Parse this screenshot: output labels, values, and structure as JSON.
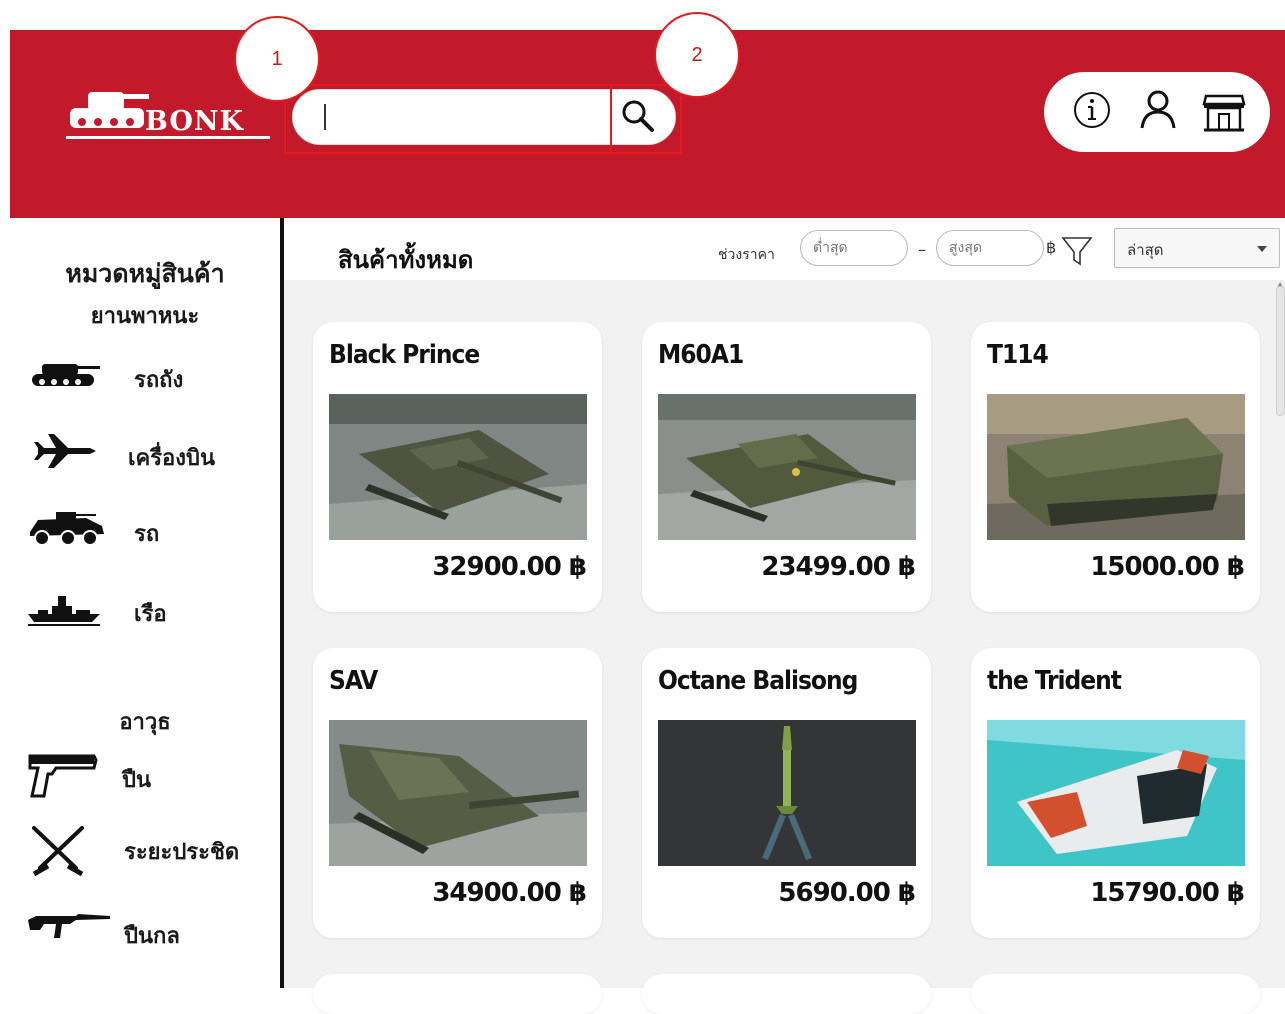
{
  "header": {
    "logo_text": "BONK",
    "search": {
      "value": "",
      "placeholder": ""
    },
    "annotations": [
      "1",
      "2"
    ],
    "icons": [
      "info-icon",
      "user-icon",
      "store-icon"
    ]
  },
  "sidebar": {
    "title": "หมวดหมู่สินค้า",
    "vehicles_heading": "ยานพาหนะ",
    "vehicles": [
      {
        "label": "รถถัง",
        "icon": "tank-icon"
      },
      {
        "label": "เครื่องบิน",
        "icon": "jet-icon"
      },
      {
        "label": "รถ",
        "icon": "armored-car-icon"
      },
      {
        "label": "เรือ",
        "icon": "ship-icon"
      }
    ],
    "weapons_heading": "อาวุธ",
    "weapons": [
      {
        "label": "ปืน",
        "icon": "pistol-icon"
      },
      {
        "label": "ระยะประชิด",
        "icon": "crossed-knives-icon"
      },
      {
        "label": "ปืนกล",
        "icon": "rifle-icon"
      }
    ]
  },
  "toolbar": {
    "title": "สินค้าทั้งหมด",
    "price_range_label": "ช่วงราคา",
    "min_placeholder": "ต่ำสุด",
    "max_placeholder": "สูงสุด",
    "dash": "–",
    "currency": "฿",
    "sort_value": "ล่าสุด"
  },
  "products": [
    {
      "name": "Black Prince",
      "price": "32900.00 ฿"
    },
    {
      "name": "M60A1",
      "price": "23499.00 ฿"
    },
    {
      "name": "T114",
      "price": "15000.00 ฿"
    },
    {
      "name": "SAV",
      "price": "34900.00 ฿"
    },
    {
      "name": "Octane Balisong",
      "price": "5690.00 ฿"
    },
    {
      "name": "the Trident",
      "price": "15790.00 ฿"
    }
  ],
  "colors": {
    "brand_red": "#c31a2b",
    "annotation_red": "#e21a1a"
  }
}
